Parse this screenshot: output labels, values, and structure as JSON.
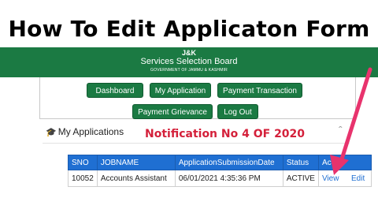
{
  "headline": "How To Edit Applicaton Form",
  "header": {
    "line1": "J&K",
    "line2": "Services Selection Board",
    "line3": "GOVERNMENT OF JAMMU & KASHMIR"
  },
  "nav": {
    "dashboard": "Dashboard",
    "my_application": "My Application",
    "payment_transaction": "Payment Transaction",
    "payment_grievance": "Payment Grievance",
    "logout": "Log Out"
  },
  "section": {
    "title": "My Applications",
    "notification": "Notification No 4 OF 2020"
  },
  "table": {
    "headers": [
      "SNO",
      "JOBNAME",
      "ApplicationSubmissionDate",
      "Status",
      "Action"
    ],
    "rows": [
      {
        "sno": "10052",
        "jobname": "Accounts Assistant",
        "date": "06/01/2021 4:35:36 PM",
        "status": "ACTIVE",
        "view": "View",
        "edit": "Edit"
      }
    ]
  },
  "colors": {
    "brand_green": "#1b7a43",
    "table_header_blue": "#1f6fd2",
    "notification_red": "#d4203a",
    "arrow_pink": "#e8336d"
  },
  "icons": [
    "graduation-cap-icon",
    "chevron-up-icon",
    "arrow-icon"
  ]
}
